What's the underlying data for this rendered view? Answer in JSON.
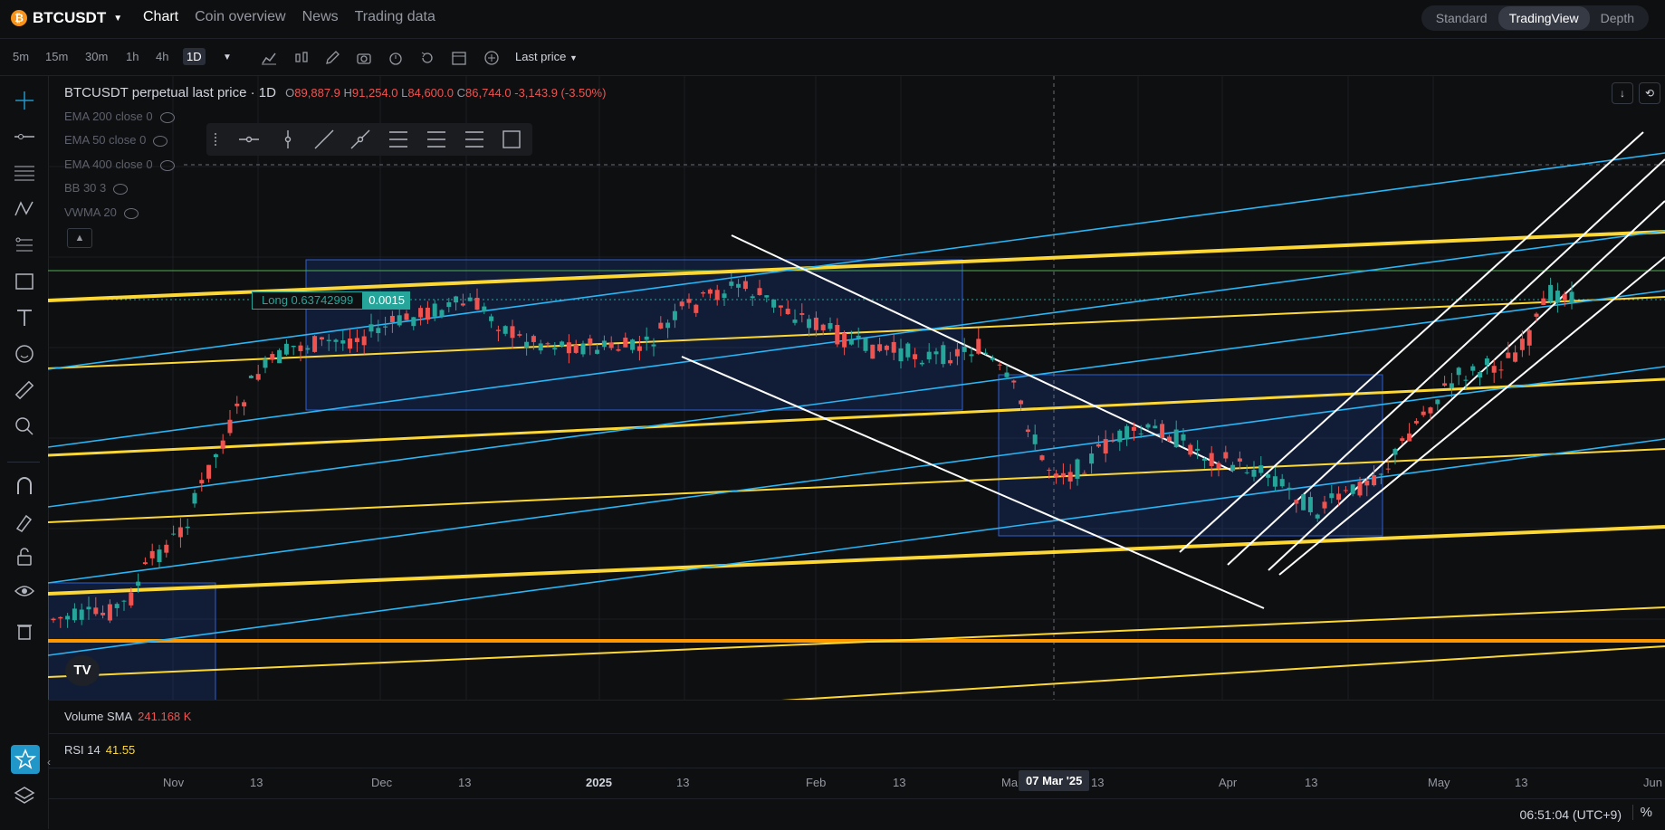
{
  "header": {
    "symbol": "BTCUSDT",
    "tabs": [
      {
        "label": "Chart",
        "active": true
      },
      {
        "label": "Coin overview",
        "active": false
      },
      {
        "label": "News",
        "active": false
      },
      {
        "label": "Trading data",
        "active": false
      }
    ],
    "views": [
      {
        "label": "Standard",
        "active": false
      },
      {
        "label": "TradingView",
        "active": true
      },
      {
        "label": "Depth",
        "active": false
      }
    ]
  },
  "toolbar": {
    "timeframes": [
      "5m",
      "15m",
      "30m",
      "1h",
      "4h",
      "1D"
    ],
    "active_timeframe": "1D",
    "price_type": "Last price"
  },
  "legend": {
    "title": "BTCUSDT perpetual last price · 1D",
    "open": "89,887.9",
    "high": "91,254.0",
    "low": "84,600.0",
    "close": "86,744.0",
    "change": "-3,143.9 (-3.50%)",
    "indicators": [
      "EMA 200 close 0",
      "EMA 50 close 0",
      "EMA 400 close 0",
      "BB 30 3",
      "VWMA 20"
    ]
  },
  "position": {
    "label": "Long 0.63742999",
    "qty": "0.0015"
  },
  "panes": {
    "volume_label": "Volume SMA",
    "volume_value": "241.168 K",
    "rsi_label": "RSI 14",
    "rsi_value": "41.55"
  },
  "xaxis": {
    "ticks": [
      "Nov",
      "13",
      "Dec",
      "13",
      "2025",
      "13",
      "Feb",
      "13",
      "Ma",
      "13",
      "Apr",
      "13",
      "May",
      "13",
      "Jun"
    ],
    "crosshair_date": "07 Mar '25"
  },
  "footer": {
    "time": "06:51:04 (UTC+9)",
    "percent": "%"
  },
  "colors": {
    "up": "#26a69a",
    "down": "#ef5350",
    "accent": "#2196c9"
  }
}
